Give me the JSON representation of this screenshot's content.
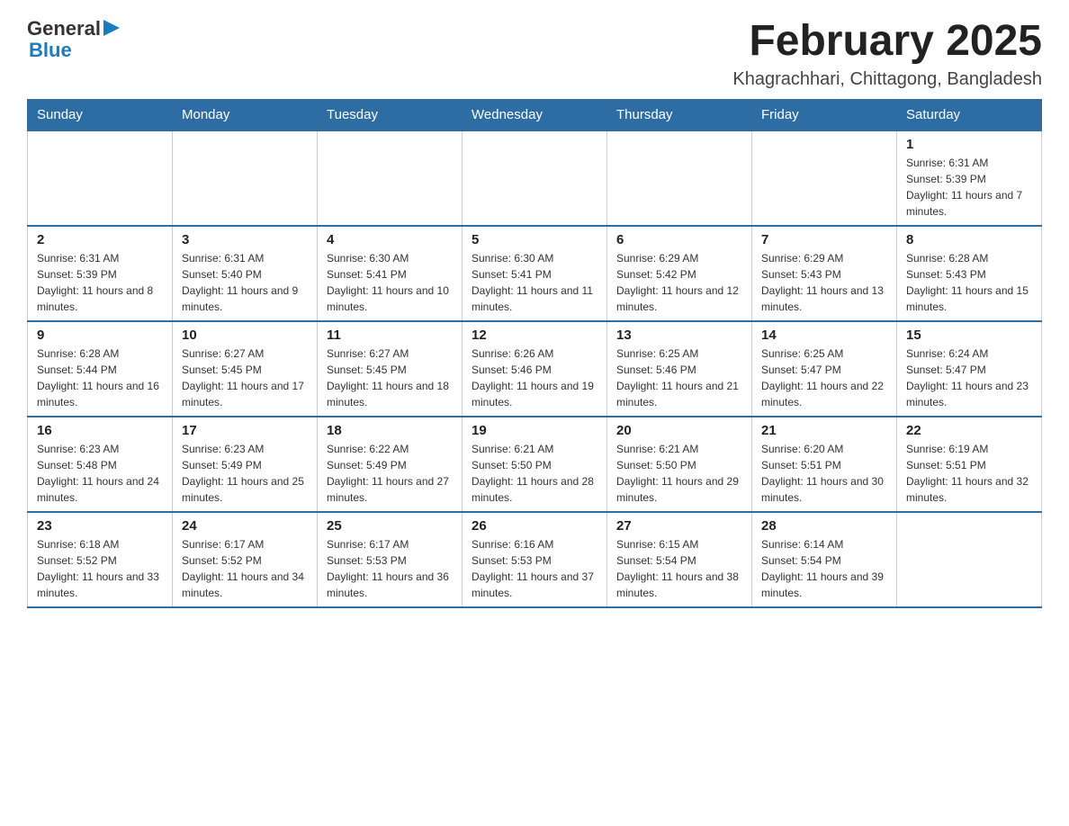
{
  "header": {
    "logo_general": "General",
    "logo_blue": "Blue",
    "title": "February 2025",
    "subtitle": "Khagrachhari, Chittagong, Bangladesh"
  },
  "weekdays": [
    "Sunday",
    "Monday",
    "Tuesday",
    "Wednesday",
    "Thursday",
    "Friday",
    "Saturday"
  ],
  "weeks": [
    [
      {
        "day": "",
        "info": ""
      },
      {
        "day": "",
        "info": ""
      },
      {
        "day": "",
        "info": ""
      },
      {
        "day": "",
        "info": ""
      },
      {
        "day": "",
        "info": ""
      },
      {
        "day": "",
        "info": ""
      },
      {
        "day": "1",
        "info": "Sunrise: 6:31 AM\nSunset: 5:39 PM\nDaylight: 11 hours and 7 minutes."
      }
    ],
    [
      {
        "day": "2",
        "info": "Sunrise: 6:31 AM\nSunset: 5:39 PM\nDaylight: 11 hours and 8 minutes."
      },
      {
        "day": "3",
        "info": "Sunrise: 6:31 AM\nSunset: 5:40 PM\nDaylight: 11 hours and 9 minutes."
      },
      {
        "day": "4",
        "info": "Sunrise: 6:30 AM\nSunset: 5:41 PM\nDaylight: 11 hours and 10 minutes."
      },
      {
        "day": "5",
        "info": "Sunrise: 6:30 AM\nSunset: 5:41 PM\nDaylight: 11 hours and 11 minutes."
      },
      {
        "day": "6",
        "info": "Sunrise: 6:29 AM\nSunset: 5:42 PM\nDaylight: 11 hours and 12 minutes."
      },
      {
        "day": "7",
        "info": "Sunrise: 6:29 AM\nSunset: 5:43 PM\nDaylight: 11 hours and 13 minutes."
      },
      {
        "day": "8",
        "info": "Sunrise: 6:28 AM\nSunset: 5:43 PM\nDaylight: 11 hours and 15 minutes."
      }
    ],
    [
      {
        "day": "9",
        "info": "Sunrise: 6:28 AM\nSunset: 5:44 PM\nDaylight: 11 hours and 16 minutes."
      },
      {
        "day": "10",
        "info": "Sunrise: 6:27 AM\nSunset: 5:45 PM\nDaylight: 11 hours and 17 minutes."
      },
      {
        "day": "11",
        "info": "Sunrise: 6:27 AM\nSunset: 5:45 PM\nDaylight: 11 hours and 18 minutes."
      },
      {
        "day": "12",
        "info": "Sunrise: 6:26 AM\nSunset: 5:46 PM\nDaylight: 11 hours and 19 minutes."
      },
      {
        "day": "13",
        "info": "Sunrise: 6:25 AM\nSunset: 5:46 PM\nDaylight: 11 hours and 21 minutes."
      },
      {
        "day": "14",
        "info": "Sunrise: 6:25 AM\nSunset: 5:47 PM\nDaylight: 11 hours and 22 minutes."
      },
      {
        "day": "15",
        "info": "Sunrise: 6:24 AM\nSunset: 5:47 PM\nDaylight: 11 hours and 23 minutes."
      }
    ],
    [
      {
        "day": "16",
        "info": "Sunrise: 6:23 AM\nSunset: 5:48 PM\nDaylight: 11 hours and 24 minutes."
      },
      {
        "day": "17",
        "info": "Sunrise: 6:23 AM\nSunset: 5:49 PM\nDaylight: 11 hours and 25 minutes."
      },
      {
        "day": "18",
        "info": "Sunrise: 6:22 AM\nSunset: 5:49 PM\nDaylight: 11 hours and 27 minutes."
      },
      {
        "day": "19",
        "info": "Sunrise: 6:21 AM\nSunset: 5:50 PM\nDaylight: 11 hours and 28 minutes."
      },
      {
        "day": "20",
        "info": "Sunrise: 6:21 AM\nSunset: 5:50 PM\nDaylight: 11 hours and 29 minutes."
      },
      {
        "day": "21",
        "info": "Sunrise: 6:20 AM\nSunset: 5:51 PM\nDaylight: 11 hours and 30 minutes."
      },
      {
        "day": "22",
        "info": "Sunrise: 6:19 AM\nSunset: 5:51 PM\nDaylight: 11 hours and 32 minutes."
      }
    ],
    [
      {
        "day": "23",
        "info": "Sunrise: 6:18 AM\nSunset: 5:52 PM\nDaylight: 11 hours and 33 minutes."
      },
      {
        "day": "24",
        "info": "Sunrise: 6:17 AM\nSunset: 5:52 PM\nDaylight: 11 hours and 34 minutes."
      },
      {
        "day": "25",
        "info": "Sunrise: 6:17 AM\nSunset: 5:53 PM\nDaylight: 11 hours and 36 minutes."
      },
      {
        "day": "26",
        "info": "Sunrise: 6:16 AM\nSunset: 5:53 PM\nDaylight: 11 hours and 37 minutes."
      },
      {
        "day": "27",
        "info": "Sunrise: 6:15 AM\nSunset: 5:54 PM\nDaylight: 11 hours and 38 minutes."
      },
      {
        "day": "28",
        "info": "Sunrise: 6:14 AM\nSunset: 5:54 PM\nDaylight: 11 hours and 39 minutes."
      },
      {
        "day": "",
        "info": ""
      }
    ]
  ]
}
